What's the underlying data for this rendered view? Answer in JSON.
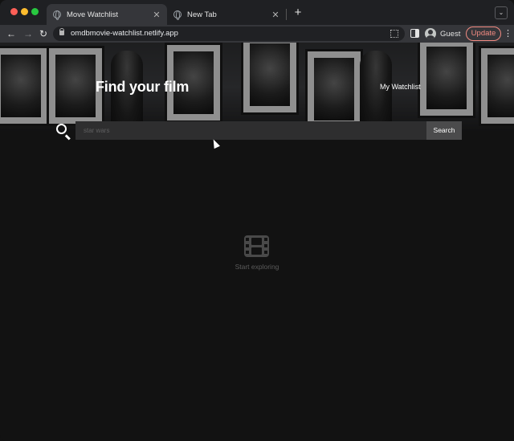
{
  "browser": {
    "tabs": [
      {
        "title": "Move Watchlist",
        "active": true
      },
      {
        "title": "New Tab",
        "active": false
      }
    ],
    "url": "omdbmovie-watchlist.netlify.app",
    "profile_name": "Guest",
    "update_label": "Update",
    "traffic_colors": {
      "close": "#fe5f57",
      "minimize": "#febc2e",
      "zoom": "#28c840"
    }
  },
  "page": {
    "heading": "Find your film",
    "watchlist_link": "My Watchlist",
    "search": {
      "placeholder": "star wars",
      "value": "",
      "button_label": "Search"
    },
    "empty_state": {
      "icon": "film-icon",
      "label": "Start exploring"
    }
  },
  "colors": {
    "page_background": "#121212",
    "update_accent": "#f28b82",
    "search_button": "#4b4b4c"
  }
}
